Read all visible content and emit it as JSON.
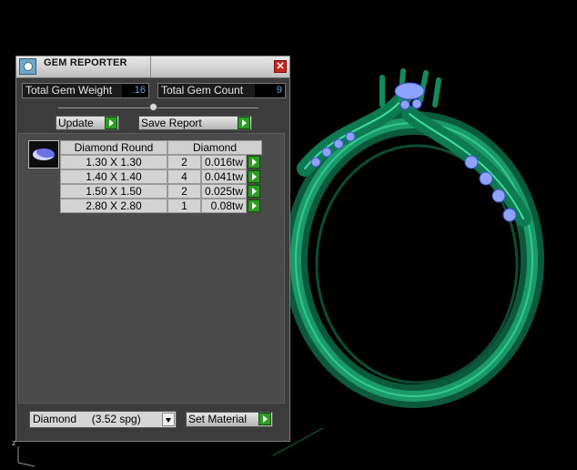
{
  "window": {
    "title": "GEM REPORTER",
    "close_glyph": "✕"
  },
  "stats": {
    "weight_label": "Total Gem Weight",
    "weight_value": ".16",
    "count_label": "Total Gem Count",
    "count_value": "9"
  },
  "actions": {
    "update_label": "Update",
    "save_label": "Save Report"
  },
  "table": {
    "headers": [
      "Diamond Round",
      "Diamond"
    ],
    "rows": [
      {
        "size": "1.30 X 1.30",
        "count": "2",
        "weight": "0.016tw"
      },
      {
        "size": "1.40 X 1.40",
        "count": "4",
        "weight": "0.041tw"
      },
      {
        "size": "1.50 X 1.50",
        "count": "2",
        "weight": "0.025tw"
      },
      {
        "size": "2.80 X 2.80",
        "count": "1",
        "weight": "0.08tw"
      }
    ]
  },
  "material": {
    "selected": "Diamond     (3.52 spg)",
    "set_label": "Set Material"
  },
  "viewport": {
    "axis_label": "z",
    "ring_color": "#0f6b4a",
    "gem_color": "#8ea2ff"
  },
  "icons": [
    "gem-reporter-app-icon",
    "close-icon",
    "green-arrow-icon",
    "dropdown-arrow-icon",
    "gem-diamond-icon"
  ]
}
